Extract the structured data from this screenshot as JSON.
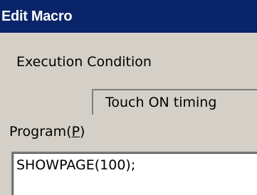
{
  "window": {
    "title": "Edit Macro"
  },
  "execution": {
    "label": "Execution Condition",
    "selected_value": "Touch ON timing"
  },
  "program": {
    "label_pre": "Program(",
    "label_mnemonic": "P",
    "label_post": ")",
    "value": "SHOWPAGE(100);"
  }
}
